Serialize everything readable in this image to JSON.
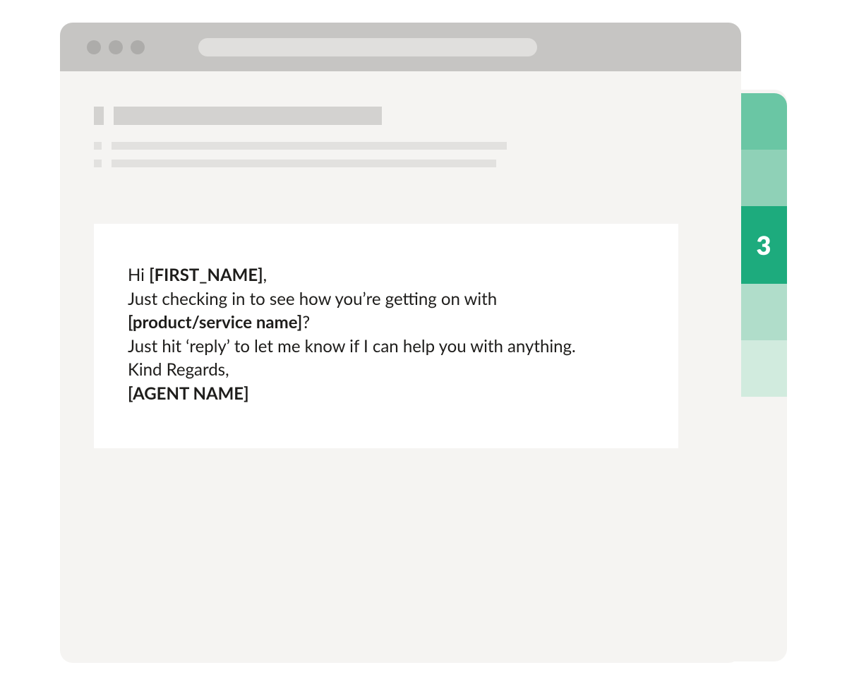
{
  "tabs": {
    "items": [
      "",
      "",
      "3",
      "",
      ""
    ],
    "active_index": 2
  },
  "email": {
    "greeting_prefix": "Hi ",
    "greeting_token": "[FIRST_NAME]",
    "greeting_suffix": ",",
    "checkin_line": "Just checking in to see how you’re getting on with",
    "product_token": "[product/service name]",
    "product_suffix": "?",
    "reply_line": "Just hit ‘reply’ to let me know if I can help you with anything.",
    "signoff": "Kind Regards,",
    "agent_token": "[AGENT NAME]"
  }
}
